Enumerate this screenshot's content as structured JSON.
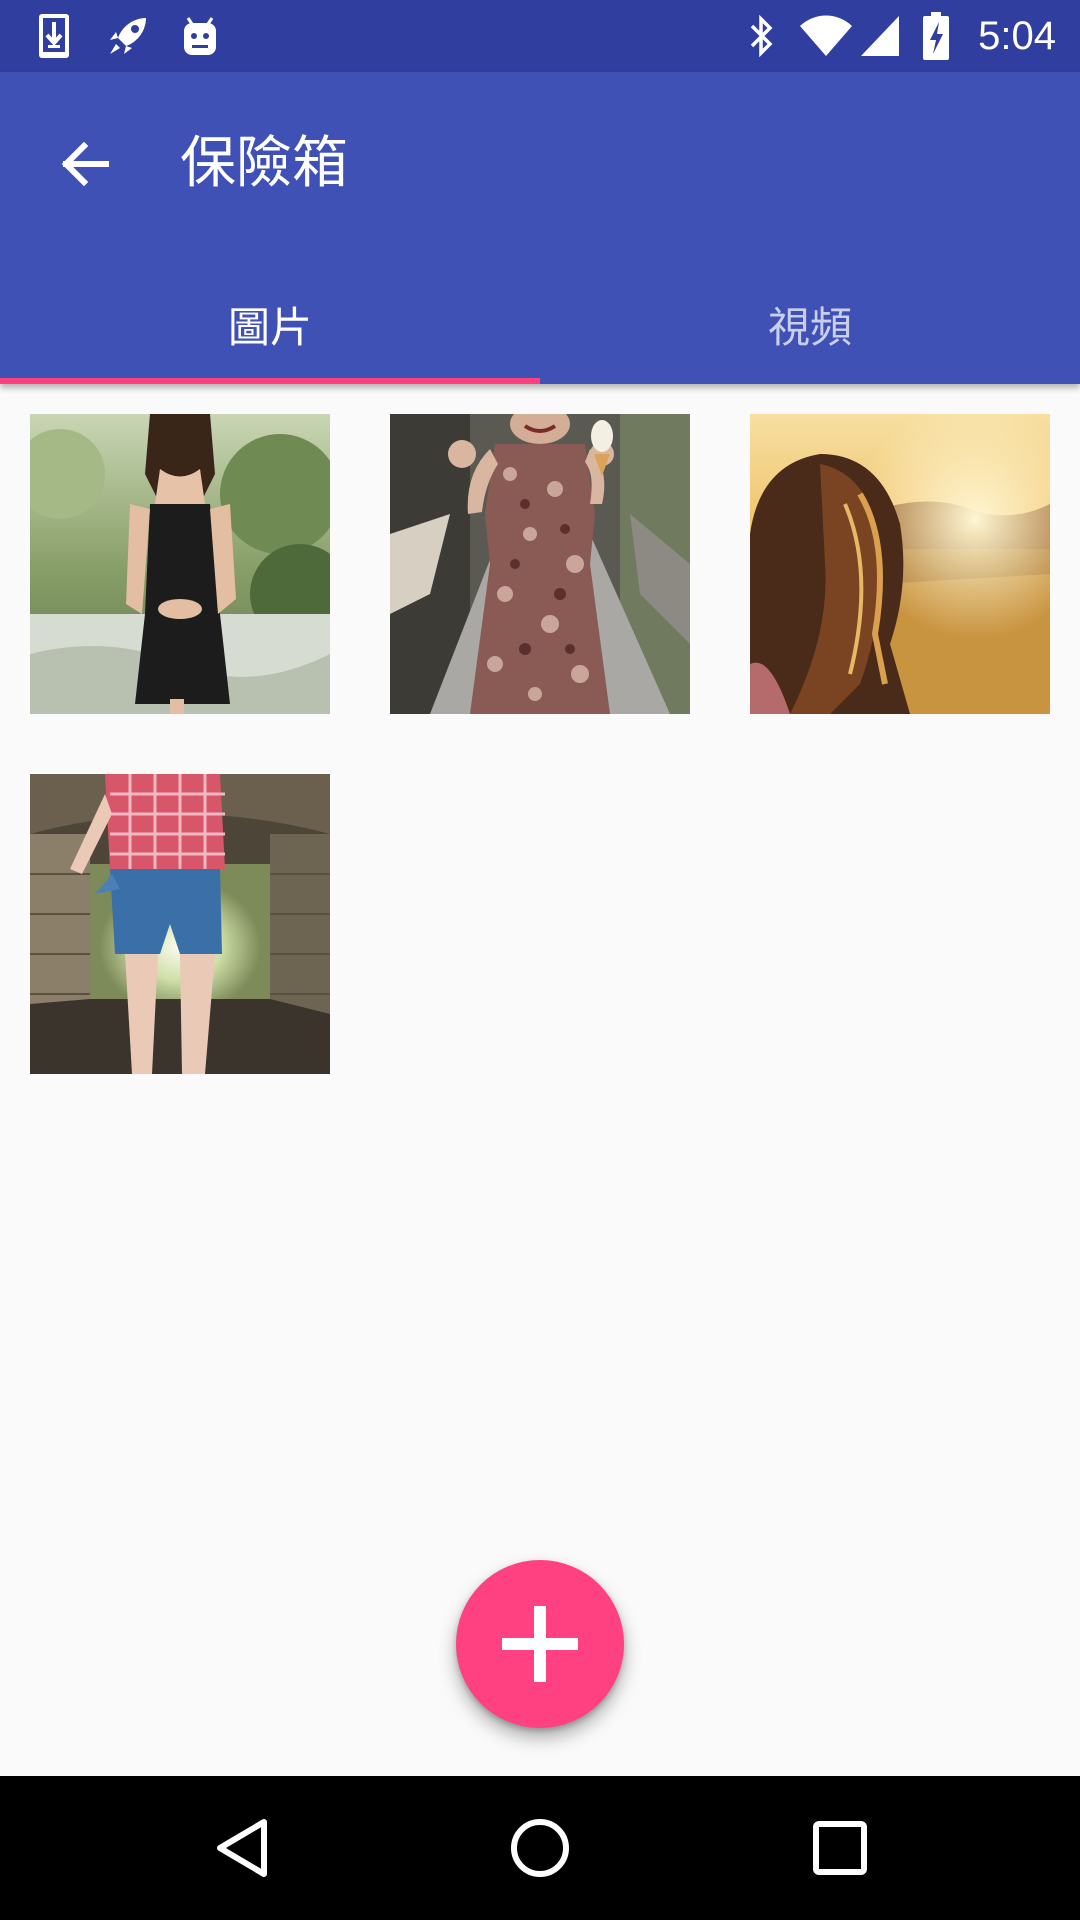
{
  "status_bar": {
    "time": "5:04",
    "left_icons": [
      "download-icon",
      "rocket-icon",
      "android-icon"
    ],
    "right_icons": [
      "bluetooth-icon",
      "wifi-icon",
      "cellular-signal-icon",
      "battery-charging-icon"
    ]
  },
  "app_bar": {
    "title": "保險箱",
    "back_icon": "arrow-back-icon"
  },
  "tabs": [
    {
      "label": "圖片",
      "active": true
    },
    {
      "label": "視頻",
      "active": false
    }
  ],
  "colors": {
    "primary": "#3f51b5",
    "primary_dark": "#303f9f",
    "accent": "#ff4081",
    "background": "#fafafa"
  },
  "gallery": {
    "items": [
      {
        "description_icon": "photo-woman-black-dress"
      },
      {
        "description_icon": "photo-woman-floral-dress-icecream"
      },
      {
        "description_icon": "photo-woman-sunset-field"
      },
      {
        "description_icon": "photo-woman-tunnel-denim-shorts"
      }
    ]
  },
  "fab": {
    "icon": "add-icon"
  },
  "nav_bar": {
    "icons": [
      "back-triangle-icon",
      "home-circle-icon",
      "recents-square-icon"
    ]
  }
}
